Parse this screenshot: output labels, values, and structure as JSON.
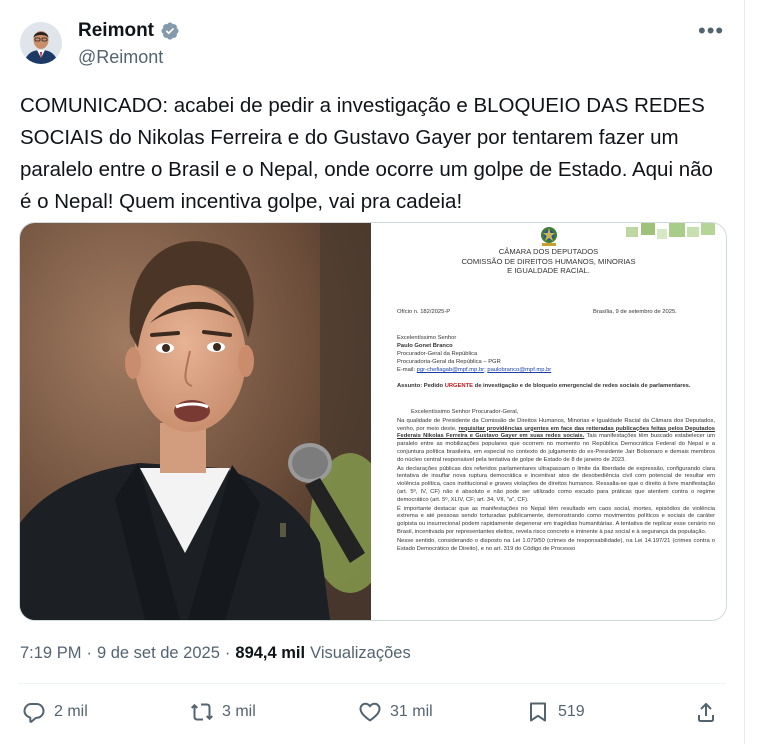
{
  "author": {
    "display_name": "Reimont",
    "handle": "@Reimont",
    "verified_icon": "verified-badge-icon",
    "more_label": "•••"
  },
  "tweet": {
    "text": "COMUNICADO: acabei de pedir a investigação e BLOQUEIO DAS REDES SOCIAIS do Nikolas Ferreira e do Gustavo Gayer por tentarem fazer um paralelo entre o Brasil e o Nepal, onde ocorre um golpe de Estado. Aqui não é o Nepal! Quem incentiva golpe, vai pra cadeia!"
  },
  "document": {
    "header_line1": "CÂMARA DOS DEPUTADOS",
    "header_line2": "COMISSÃO DE DIREITOS HUMANOS, MINORIAS",
    "header_line3": "E IGUALDADE RACIAL.",
    "office_number": "Ofício n. 182/2025-P",
    "date": "Brasília, 9 de setembro de 2025.",
    "salutation": "Excelentíssimo Senhor",
    "recipient_name": "Paulo Gonet Branco",
    "recipient_title": "Procurador-Geral da República",
    "recipient_org": "Procuradoria-Geral da República – PGR",
    "email_label": "E-mail:",
    "email_1": "pgr-chefiagab@mpf.mp.br",
    "email_2": "paulobranco@mpf.mp.br",
    "subject_label": "Assunto: Pedido",
    "subject_urgent": "URGENTE",
    "subject_rest": "de investigação e de bloqueio emergencial de redes sociais de parlamentares.",
    "greeting": "Excelentíssimo Senhor Procurador-Geral,",
    "para1_a": "Na qualidade de Presidente da Comissão de Direitos Humanos, Minorias e Igualdade Racial da Câmara dos Deputados, venho, por meio deste,",
    "para1_b": "requisitar providências urgentes em face das reiteradas publicações feitas pelos Deputados Federais Nikolas Ferreira e Gustavo Gayer em suas redes sociais.",
    "para1_c": "Tais manifestações têm buscado estabelecer um paralelo entre as mobilizações populares que ocorrem no momento no República Democrática Federal do Nepal e a conjuntura política brasileira, em especial no contexto do julgamento do ex-Presidente Jair Bolsonaro e demais membros do núcleo central responsável pela tentativa de golpe de Estado de 8 de janeiro de 2023.",
    "para2": "As declarações públicas dos referidos parlamentares ultrapassam o limite da liberdade de expressão, configurando clara tentativa de insuflar nova ruptura democrática e incentivar atos de desobediência civil com potencial de resultar em violência política, caos institucional e graves violações de direitos humanos. Ressalta-se que o direito à livre manifestação (art. 5º, IV, CF) não é absoluto e não pode ser utilizado como escudo para práticas que atentem contra o regime democrático (art. 5º, XLIV, CF; art. 34, VII, \"a\", CF).",
    "para3": "É importante destacar que as manifestações no Nepal têm resultado em caos social, mortes, episódios de violência extrema e até pessoas sendo torturadas publicamente, demonstrando como movimentos políticos e sociais de caráter golpista ou insurrecional podem rapidamente degenerar em tragédias humanitárias. A tentativa de replicar esse cenário no Brasil, incentivada por representantes eleitos, revela risco concreto e iminente à paz social e à segurança da população.",
    "para4": "Nesse sentido, considerando o disposto na Lei 1.079/50 (crimes de responsabilidade), na Lei 14.197/21 (crimes contra o Estado Democrático de Direito), e no art. 319 do Código de Processo"
  },
  "meta": {
    "time": "7:19 PM",
    "sep1": "·",
    "date": "9 de set de 2025",
    "sep2": "·",
    "views_count": "894,4 mil",
    "views_label": "Visualizações"
  },
  "actions": {
    "replies": "2 mil",
    "reposts": "3 mil",
    "likes": "31 mil",
    "bookmarks": "519"
  },
  "colors": {
    "text": "#0f1419",
    "secondary": "#536471",
    "verified": "#829aab",
    "border": "#cfd9de"
  }
}
